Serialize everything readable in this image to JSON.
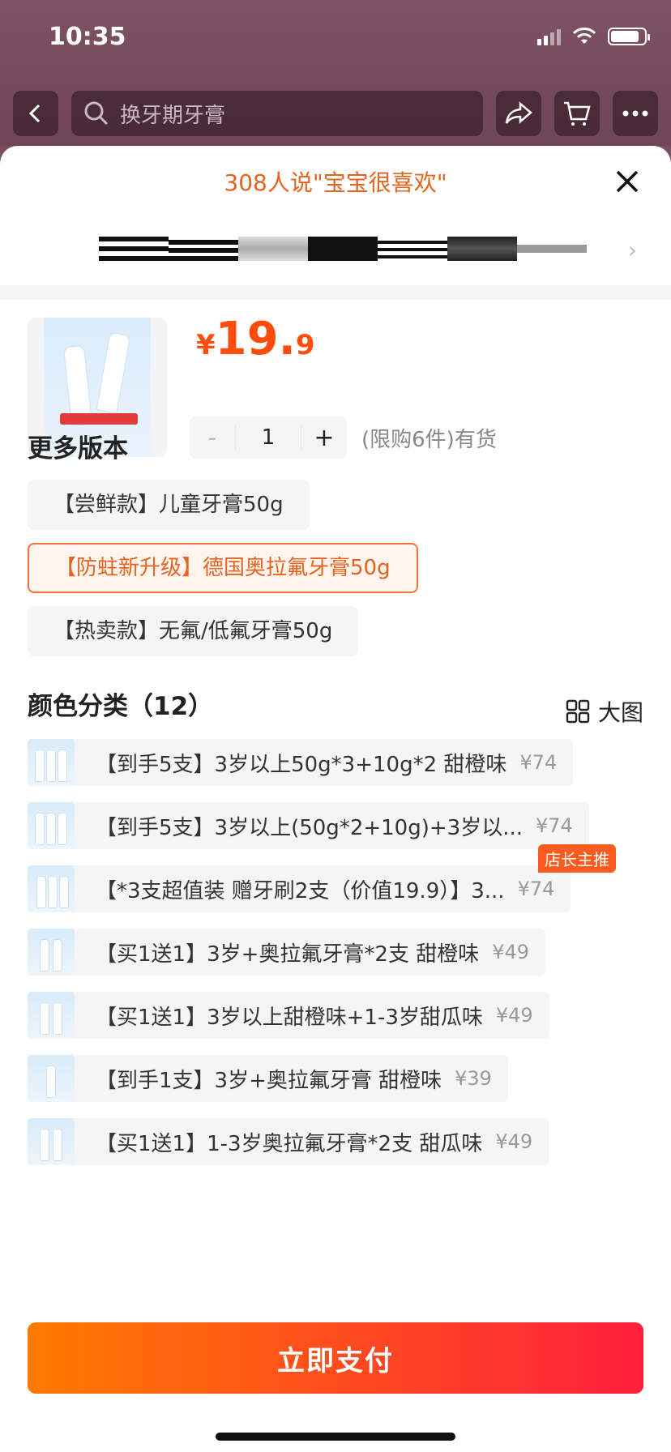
{
  "status": {
    "time": "10:35"
  },
  "search": {
    "placeholder": "换牙期牙膏"
  },
  "sheet": {
    "header": "308人说\"宝宝很喜欢\"",
    "price": {
      "currency": "¥",
      "integer": "19.",
      "decimal": "9"
    },
    "quantity": {
      "minus": "-",
      "value": "1",
      "plus": "+"
    },
    "stock_note": "(限购6件)有货",
    "more_versions_title": "更多版本",
    "versions": [
      "【尝鲜款】儿童牙膏50g",
      "【防蛀新升级】德国奥拉氟牙膏50g",
      "【热卖款】无氟/低氟牙膏50g"
    ],
    "selected_version_index": 1,
    "color_title": "颜色分类（12）",
    "big_view_label": "大图",
    "options": [
      {
        "label": "【到手5支】3岁以上50g*3+10g*2 甜橙味",
        "price": "¥74"
      },
      {
        "label": "【到手5支】3岁以上(50g*2+10g)+3岁以...",
        "price": "¥74"
      },
      {
        "label": "【*3支超值装 赠牙刷2支（价值19.9）】3...",
        "price": "¥74",
        "badge": "店长主推"
      },
      {
        "label": "【买1送1】3岁+奥拉氟牙膏*2支 甜橙味",
        "price": "¥49"
      },
      {
        "label": "【买1送1】3岁以上甜橙味+1-3岁甜瓜味",
        "price": "¥49"
      },
      {
        "label": "【到手1支】3岁+奥拉氟牙膏 甜橙味",
        "price": "¥39"
      },
      {
        "label": "【买1送1】1-3岁奥拉氟牙膏*2支 甜瓜味",
        "price": "¥49"
      }
    ],
    "pay_button": "立即支付"
  },
  "colors": {
    "accent": "#e5641f",
    "price": "#ff4d10",
    "pay_start": "#ff7a00",
    "pay_end": "#ff1f3d"
  },
  "icons": [
    "back-icon",
    "search-icon",
    "share-icon",
    "cart-icon",
    "more-icon",
    "close-icon",
    "grid-icon",
    "chevron-right-icon"
  ]
}
